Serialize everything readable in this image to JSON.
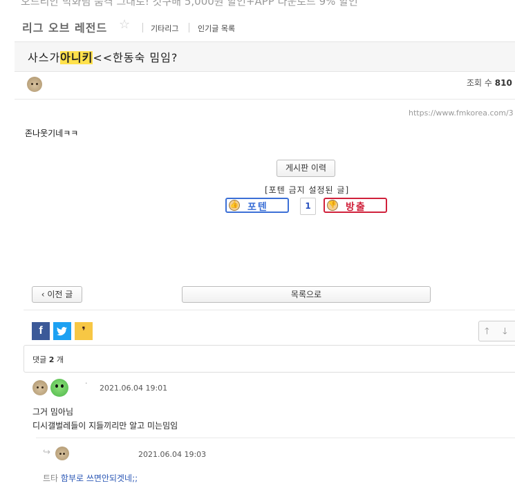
{
  "ad": {
    "text": "오드리안 박화림 품격 그대로! 갓쿠배 5,000원 할인+APP 다운로드 9% 할인"
  },
  "board": {
    "name": "리그 오브 레전드",
    "star_icon": "star-outline-icon",
    "links": [
      "기타리그",
      "인기글 목록"
    ]
  },
  "post": {
    "title_pre": "사스가",
    "title_highlight": "아니키",
    "title_post": "<<한동숙 밈임?",
    "views_label": "조회 수",
    "views_value": "810",
    "url": "https://www.fmkorea.com/3",
    "body": "존나웃기네ㅋㅋ",
    "history_button": "게시판 이력",
    "banned_note": "[포텐 금지 설정된 글]",
    "vote_up_label": "포텐",
    "vote_count": "1",
    "vote_down_label": "방출"
  },
  "nav": {
    "prev_label": "이전 글",
    "list_label": "목록으로"
  },
  "share": {
    "facebook": "f",
    "twitter": "twitter-bird-icon",
    "kakao": "kakao-story-icon"
  },
  "comments_header": {
    "label": "댓글",
    "count": "2",
    "unit": "개"
  },
  "comments": [
    {
      "author": "·",
      "time": "2021.06.04 19:01",
      "lines": [
        "그거 밈아님",
        "디시갤벌레들이 지들끼리만 알고 미는밈임"
      ]
    },
    {
      "time": "2021.06.04 19:03",
      "mention": "트타",
      "text": "함부로 쓰면안되겟네;;"
    }
  ],
  "colors": {
    "highlight": "#ffe14b",
    "vote_up": "#3b6fd6",
    "vote_down": "#d0203a",
    "facebook": "#3b5998",
    "twitter": "#1da1f2",
    "kakao": "#f7c744",
    "link": "#2b57b5"
  }
}
